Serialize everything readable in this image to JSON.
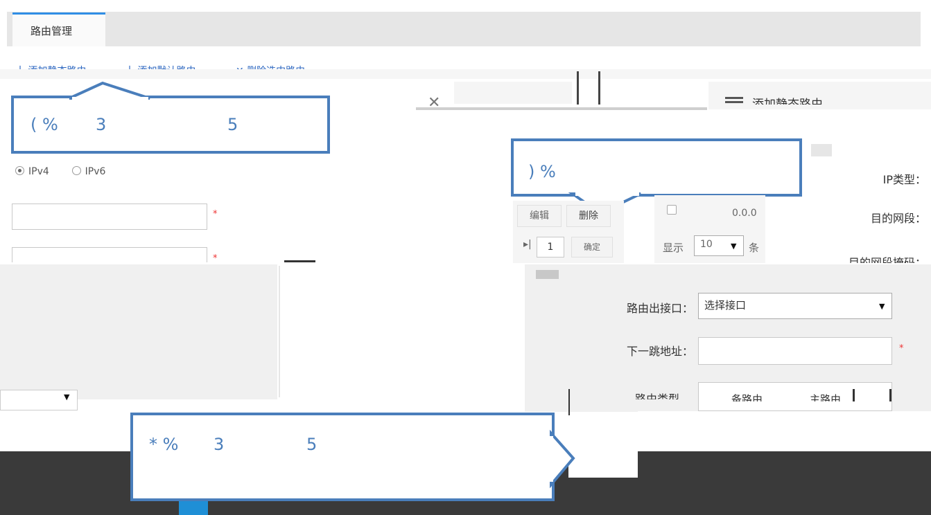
{
  "tabs": {
    "active": "路由管理"
  },
  "toolbar": {
    "add_static": "十 添加静态路由",
    "add_default": "十 添加默认路由",
    "delete_selected": "✕ 删除选中路由"
  },
  "panel_title": {
    "icon": "hamburger-icon",
    "text": "添加静态路由"
  },
  "callouts": [
    {
      "label": "( %",
      "n1": "3",
      "n2": "5"
    },
    {
      "label": ") %"
    },
    {
      "label": "* %",
      "n1": "3",
      "n2": "5"
    }
  ],
  "ip_radio": {
    "ipv4": "IPv4",
    "ipv6": "IPv6",
    "selected": "IPv4"
  },
  "required_mark": "*",
  "form_labels": {
    "ip_type": "IP类型：",
    "dest": "目的网段：",
    "mask": "目的网段掩码："
  },
  "table": {
    "edit": "编辑",
    "delete": "删除",
    "cell_value": "0.0.0",
    "page_no": "1",
    "confirm": "确定",
    "show_label": "显示",
    "page_size": "10",
    "unit": "条"
  },
  "dialog": {
    "iface_label": "路由出接口：",
    "iface_value": "选择接口",
    "next_hop_label": "下一跳地址：",
    "route_type_label": "路由类型",
    "opt_backup": "备路由",
    "opt_main": "主路由"
  },
  "colors": {
    "accent": "#2f8ee5",
    "callout": "#4a7ebb",
    "required": "#e33333",
    "link": "#2b66c0"
  }
}
